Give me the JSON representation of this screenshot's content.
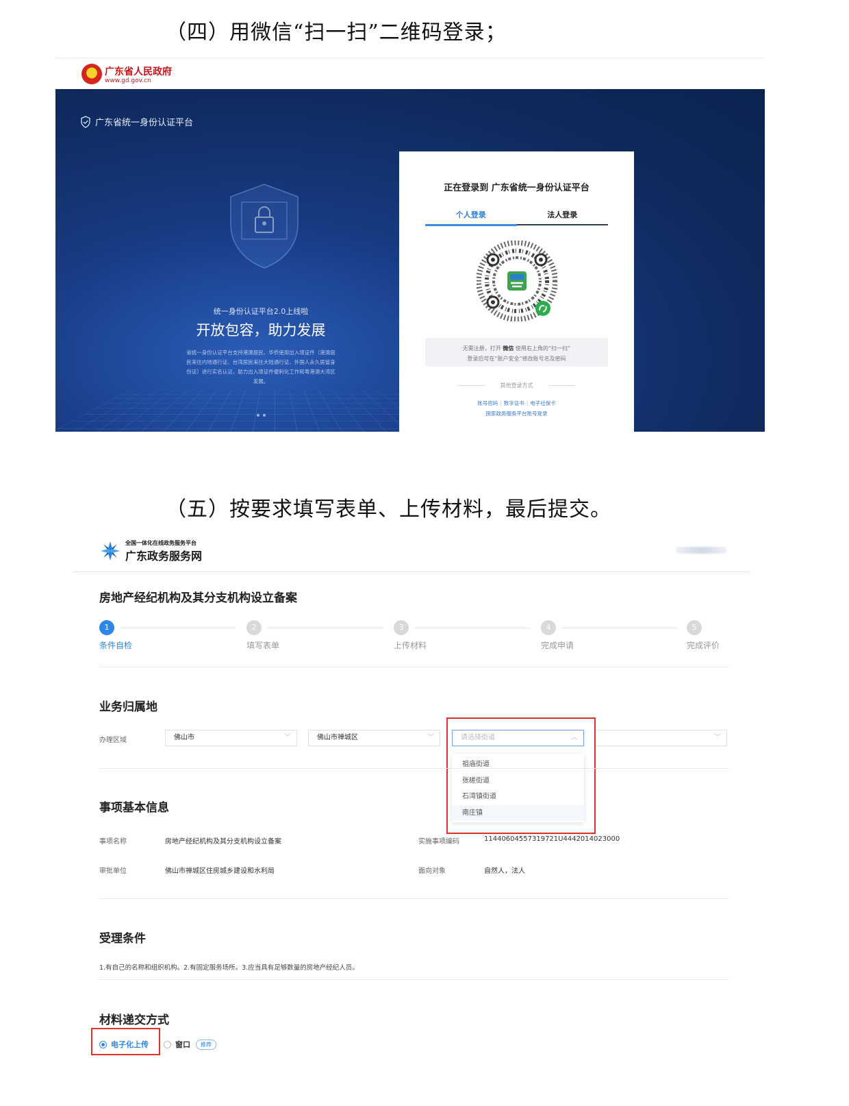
{
  "headings": {
    "step4": "（四）用微信“扫一扫”二维码登录；",
    "step5": "（五）按要求填写表单、上传材料，最后提交。"
  },
  "gov_site": {
    "name": "广东省人民政府",
    "url": "www.gd.gov.cn"
  },
  "login_page": {
    "platform_title": "广东省统一身份认证平台",
    "slogan_sub": "统一身份认证平台2.0上线啦",
    "slogan_main": "开放包容，助力发展",
    "slogan_desc": "省统一身份认证平台支持港澳居民、华侨使用出入境证件（港澳居民来往内地通行证、台湾居民来往大陆通行证、外国人永久居留身份证）进行实名认证，助力出入境证件便利化工作和粤港澳大湾区发展。",
    "card_title": "正在登录到 广东省统一身份认证平台",
    "tabs": [
      {
        "label": "个人登录"
      },
      {
        "label": "法人登录"
      }
    ],
    "qr_hint_prefix": "无需注册，打开",
    "qr_hint_bold": "微信",
    "qr_hint_suffix": "使用右上角的“扫一扫”",
    "qr_hint_line2": "登录后可在“账户安全”修改账号名及密码",
    "other_title": "其他登录方式",
    "other_links": [
      "账号密码",
      "数字证书",
      "电子社保卡"
    ],
    "other_link_national": "国家政务服务平台账号登录"
  },
  "service_site": {
    "sub_title": "全国一体化在线政务服务平台",
    "name": "广东政务服务网",
    "page_title": "房地产经纪机构及其分支机构设立备案",
    "steps": [
      {
        "num": "1",
        "label": "条件自检"
      },
      {
        "num": "2",
        "label": "填写表单"
      },
      {
        "num": "3",
        "label": "上传材料"
      },
      {
        "num": "4",
        "label": "完成申请"
      },
      {
        "num": "5",
        "label": "完成评价"
      }
    ],
    "region_section": "业务归属地",
    "region_label": "办理区域",
    "select_city": "佛山市",
    "select_district": "佛山市禅城区",
    "select_street_placeholder": "请选择街道",
    "street_options": [
      "祖庙街道",
      "张槎街道",
      "石湾镇街道",
      "南庄镇"
    ],
    "basic_section": "事项基本信息",
    "info": {
      "name_label": "事项名称",
      "name_value": "房地产经纪机构及其分支机构设立备案",
      "code_label": "实施事项编码",
      "code_value": "11440604557319721U4442014023000",
      "unit_label": "审批单位",
      "unit_value": "佛山市禅城区住房城乡建设和水利局",
      "target_label": "面向对象",
      "target_value": "自然人，法人"
    },
    "conditions_section": "受理条件",
    "conditions_text": "1.有自己的名称和组织机构。2.有固定服务场所。3.应当具有足够数量的房地产经纪人员。",
    "submit_section": "材料递交方式",
    "option_online": "电子化上传",
    "option_window": "窗口",
    "tag_recommend": "推荐"
  },
  "colors": {
    "accent": "#2d86e8",
    "highlight": "#e0302a",
    "login_bg": "#0f2a5e",
    "gov_red": "#c8161d"
  },
  "icons": [
    "emblem-icon",
    "shield-icon",
    "lock-shield-icon",
    "qr-code-icon",
    "wechat-icon",
    "gd-logo-icon",
    "chevron-down-icon",
    "chevron-up-icon"
  ]
}
